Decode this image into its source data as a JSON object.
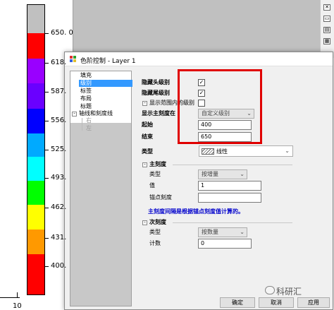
{
  "colorbar": {
    "segments": [
      "#c0c0c0",
      "#ff0000",
      "#9900ff",
      "#6a00ff",
      "#0000ff",
      "#00aaff",
      "#00ffff",
      "#00ff00",
      "#ffff00",
      "#ff9900",
      "#ff0000",
      "#ff0000",
      "#000000"
    ],
    "tick_labels": [
      "650. 0",
      "618.",
      "587.",
      "556.",
      "525.",
      "493.",
      "462.",
      "431.",
      "400."
    ],
    "bottom_number": "10"
  },
  "dialog": {
    "title": "色阶控制 - Layer 1",
    "tree": {
      "items": [
        "填充",
        "级别",
        "标签",
        "布局",
        "标题",
        "轴线和刻度线",
        "右",
        "左"
      ],
      "selected_index": 1
    },
    "form": {
      "hide_first_level": {
        "label": "隐藏头级别",
        "checked": true
      },
      "hide_last_level": {
        "label": "隐藏尾级别",
        "checked": true
      },
      "show_inner_levels": {
        "label": "显示范围内的级别",
        "checked": false
      },
      "show_major_at": {
        "label": "显示主刻度在",
        "value": "自定义级别"
      },
      "from": {
        "label": "起始",
        "value": "400"
      },
      "to": {
        "label": "结束",
        "value": "650"
      },
      "type": {
        "label": "类型",
        "value": "线性"
      },
      "major": {
        "header": "主刻度",
        "type_label": "类型",
        "type_value": "按增量",
        "value_label": "值",
        "value_value": "1",
        "anchor_label": "锚点刻度",
        "anchor_value": "",
        "note": "主刻度间隔是根据锚点刻度值计算的。"
      },
      "minor": {
        "header": "次刻度",
        "type_label": "类型",
        "type_value": "按数量",
        "count_label": "计数",
        "count_value": "0"
      }
    },
    "buttons": {
      "ok": "确定",
      "cancel": "取消",
      "apply": "应用"
    }
  },
  "watermark": "科研汇",
  "highlight_color": "#e00000"
}
